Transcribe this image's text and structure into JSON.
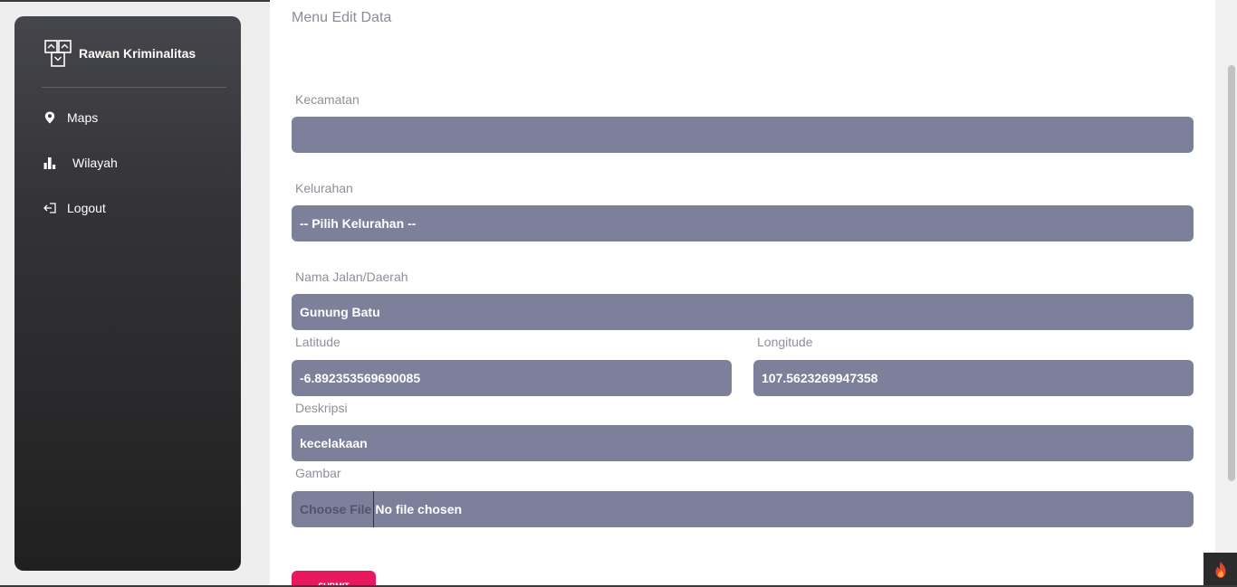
{
  "brand": {
    "title": "Rawan Kriminalitas",
    "logo_icon": "building-map-icon"
  },
  "nav": {
    "maps": {
      "label": "Maps",
      "icon": "map-pin-icon"
    },
    "wilayah": {
      "label": "Wilayah",
      "icon": "bar-chart-icon"
    },
    "logout": {
      "label": "Logout",
      "icon": "logout-icon"
    }
  },
  "page": {
    "title": "Menu Edit Data"
  },
  "form": {
    "kecamatan": {
      "label": "Kecamatan",
      "value": ""
    },
    "kelurahan": {
      "label": "Kelurahan",
      "value": "-- Pilih Kelurahan --"
    },
    "nama_jalan": {
      "label": "Nama Jalan/Daerah",
      "value": "Gunung Batu"
    },
    "latitude": {
      "label": "Latitude",
      "value": "-6.892353569690085"
    },
    "longitude": {
      "label": "Longitude",
      "value": "107.5623269947358"
    },
    "deskripsi": {
      "label": "Deskripsi",
      "value": "kecelakaan"
    },
    "gambar": {
      "label": "Gambar",
      "button": "Choose File",
      "file_status": "No file chosen"
    },
    "submit": {
      "label": "SUBMIT"
    }
  },
  "colors": {
    "field_bg": "#7c809a",
    "submit_bg": "#e8185f",
    "sidebar_dark": "#202020"
  }
}
